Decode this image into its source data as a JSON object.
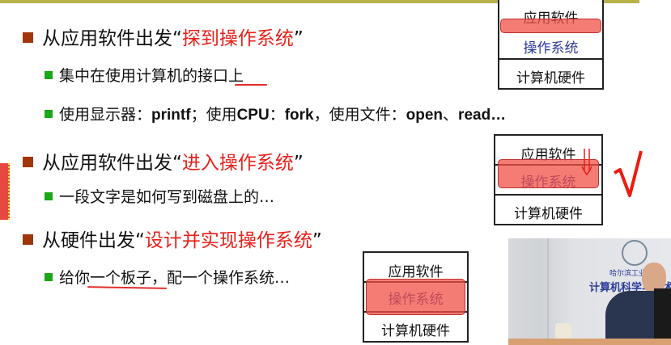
{
  "slide": {
    "bullets": [
      {
        "prefix": "从应用软件出发“",
        "highlight": "探到操作系统",
        "suffix": "”",
        "subs": [
          {
            "text_a": "集中在使用计算机的",
            "text_b": "接口",
            "text_c": "上"
          },
          {
            "p1": "使用显示器：",
            "c1": "printf",
            "p2": "；使用",
            "c2": "CPU",
            "p3": "：",
            "c3": "fork",
            "p4": "，使用文件：",
            "c4": "open",
            "p5": "、",
            "c5": "read…"
          }
        ]
      },
      {
        "prefix": "从应用软件出发“",
        "highlight": "进入操作系统",
        "suffix": "”",
        "subs": [
          {
            "text": "一段文字是如何写到磁盘上的…"
          }
        ]
      },
      {
        "prefix": "从硬件出发“",
        "highlight": "设计并实现操作系统",
        "suffix": "”",
        "subs": [
          {
            "text": "给你一个板子，配一个操作系统…"
          }
        ]
      }
    ],
    "stack": {
      "app": "应用软件",
      "os": "操作系统",
      "hw": "计算机硬件"
    },
    "checkmark": "√"
  },
  "video": {
    "banner_small": "哈尔滨工业大学",
    "banner_large": "计算机科学与技术学院"
  },
  "colors": {
    "accent_red": "#e8201a",
    "bullet_brown": "#a0360a",
    "bullet_green": "#1aa81a",
    "os_blue": "#2c3a9a",
    "highlight": "#f05046"
  }
}
